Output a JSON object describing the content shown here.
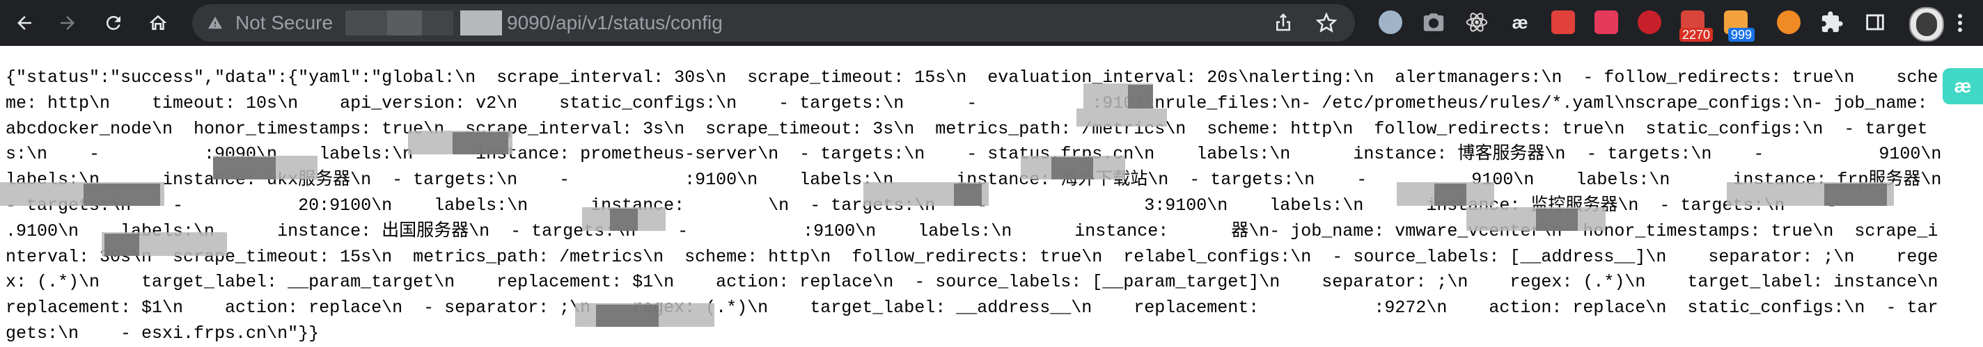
{
  "browser": {
    "security_label": "Not Secure",
    "url_visible": "9090/api/v1/status/config",
    "extension_badges": {
      "mail_count": "2270",
      "rss_count": "999"
    },
    "icons": [
      "back-icon",
      "forward-icon",
      "reload-icon",
      "home-icon",
      "warning-icon",
      "share-icon",
      "star-icon",
      "puzzle-icon",
      "sidebar-icon",
      "menu-icon"
    ]
  },
  "page": {
    "raw_text": "{\"status\":\"success\",\"data\":{\"yaml\":\"global:\\n  scrape_interval: 30s\\n  scrape_timeout: 15s\\n  evaluation_interval: 20s\\nalerting:\\n  alertmanagers:\\n  - follow_redirects: true\\n    scheme: http\\n    timeout: 10s\\n    api_version: v2\\n    static_configs:\\n    - targets:\\n      -           :9103\\nrule_files:\\n- /etc/prometheus/rules/*.yaml\\nscrape_configs:\\n- job_name: abcdocker_node\\n  honor_timestamps: true\\n  scrape_interval: 3s\\n  scrape_timeout: 3s\\n  metrics_path: /metrics\\n  scheme: http\\n  follow_redirects: true\\n  static_configs:\\n  - targets:\\n    -          :9090\\n    labels:\\n      instance: prometheus-server\\n  - targets:\\n    - status.frps.cn\\n    labels:\\n      instance: 博客服务器\\n  - targets:\\n    -           9100\\n    labels:\\n      instance: ukx服务器\\n  - targets:\\n    -           :9100\\n    labels:\\n      instance: 海外下载站\\n  - targets:\\n    -          9100\\n    labels:\\n      instance: frp服务器\\n  - targets:\\n    -           20:9100\\n    labels:\\n      instance:        \\n  - targets:\\n    -               3:9100\\n    labels:\\n      instance: 监控服务器\\n  - targets:\\n    -           .9100\\n    labels:\\n      instance: 出国服务器\\n  - targets:\\n    -           :9100\\n    labels:\\n      instance:      器\\n- job_name: vmware_vcenter\\n  honor_timestamps: true\\n  scrape_interval: 30s\\n  scrape_timeout: 15s\\n  metrics_path: /metrics\\n  scheme: http\\n  follow_redirects: true\\n  relabel_configs:\\n  - source_labels: [__address__]\\n    separator: ;\\n    regex: (.*)\\n    target_label: __param_target\\n    replacement: $1\\n    action: replace\\n  - source_labels: [__param_target]\\n    separator: ;\\n    regex: (.*)\\n    target_label: instance\\n    replacement: $1\\n    action: replace\\n  - separator: ;\\n    regex: (.*)\\n    target_label: __address__\\n    replacement:           :9272\\n    action: replace\\n  static_configs:\\n  - targets:\\n    - esxi.frps.cn\\n\"}}"
  },
  "colors": {
    "toolbar_bg": "#202124",
    "omnibox_bg": "#35363a",
    "url_text": "#9aa0a6",
    "page_text": "#000000",
    "side_tab": "#3fd9c6"
  }
}
